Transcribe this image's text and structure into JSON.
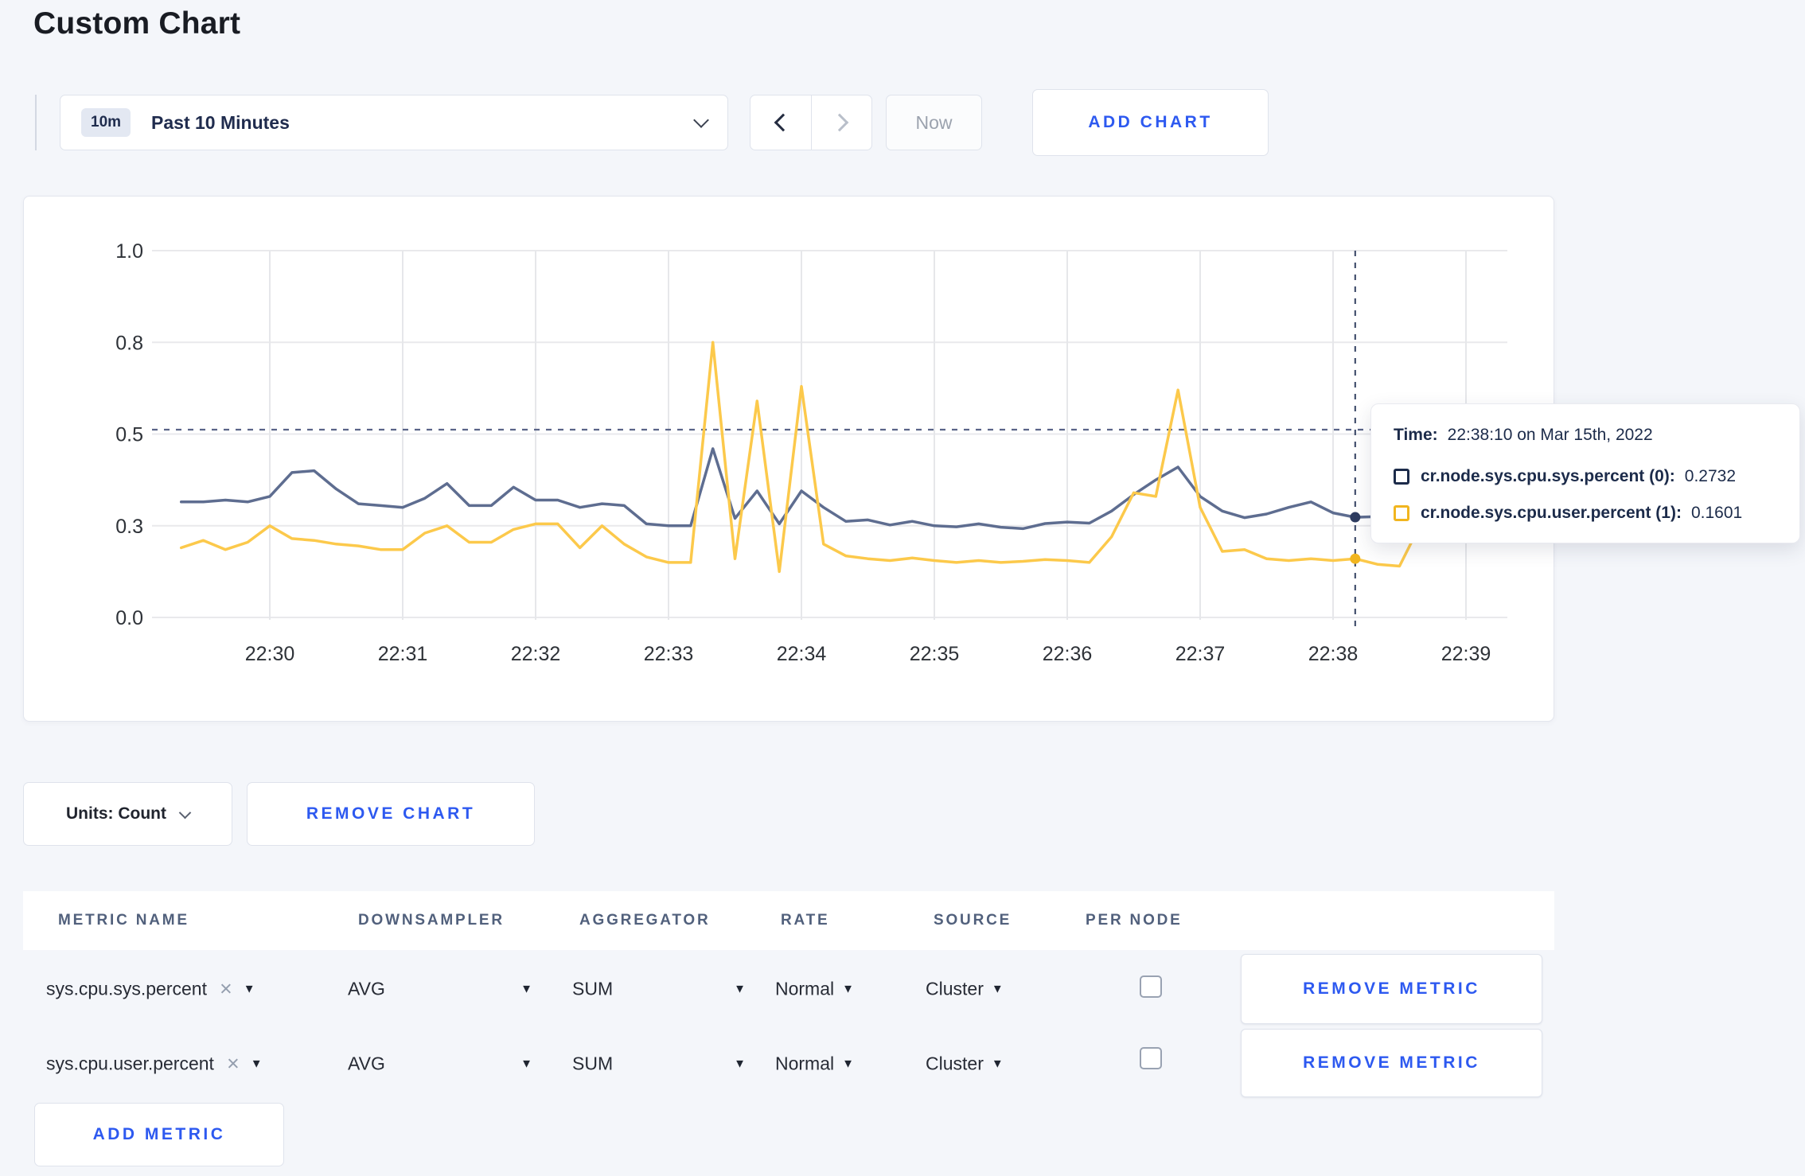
{
  "page": {
    "title": "Custom Chart"
  },
  "toolbar": {
    "range_badge": "10m",
    "range_label": "Past 10 Minutes",
    "now_label": "Now",
    "add_chart_label": "ADD CHART"
  },
  "chart_footer": {
    "units_label": "Units: Count",
    "remove_chart_label": "REMOVE CHART"
  },
  "tooltip": {
    "time_label": "Time:",
    "time_value": "22:38:10 on Mar 15th, 2022",
    "rows": [
      {
        "name": "cr.node.sys.cpu.sys.percent (0):",
        "value": "0.2732",
        "swatch": "#1c2b4a"
      },
      {
        "name": "cr.node.sys.cpu.user.percent (1):",
        "value": "0.1601",
        "swatch": "#f1b51f"
      }
    ]
  },
  "chart_data": {
    "type": "line",
    "title": "",
    "xlabel": "",
    "ylabel": "",
    "ylim": [
      0,
      1
    ],
    "grid": true,
    "x_tick_labels": [
      "22:30",
      "22:31",
      "22:32",
      "22:33",
      "22:34",
      "22:35",
      "22:36",
      "22:37",
      "22:38",
      "22:39"
    ],
    "y_tick_labels": [
      "0.0",
      "0.3",
      "0.5",
      "0.8",
      "1.0"
    ],
    "y_tick_values": [
      0,
      0.25,
      0.5,
      0.75,
      1.0
    ],
    "x_start_sec_from_2230": -40,
    "x_step_sec": 10,
    "series": [
      {
        "name": "cr.node.sys.cpu.sys.percent (0)",
        "color": "#5e6d90",
        "dot_color": "#2e3c60",
        "values": [
          0.315,
          0.315,
          0.32,
          0.315,
          0.33,
          0.395,
          0.4,
          0.35,
          0.31,
          0.305,
          0.3,
          0.325,
          0.365,
          0.305,
          0.305,
          0.355,
          0.32,
          0.32,
          0.3,
          0.31,
          0.305,
          0.255,
          0.25,
          0.25,
          0.46,
          0.27,
          0.345,
          0.255,
          0.345,
          0.3,
          0.262,
          0.266,
          0.252,
          0.262,
          0.25,
          0.247,
          0.255,
          0.246,
          0.242,
          0.256,
          0.26,
          0.257,
          0.29,
          0.335,
          0.375,
          0.41,
          0.33,
          0.29,
          0.272,
          0.282,
          0.3,
          0.315,
          0.285,
          0.2732,
          0.275,
          0.27,
          0.272,
          0.27,
          0.268,
          0.27
        ]
      },
      {
        "name": "cr.node.sys.cpu.user.percent (1)",
        "color": "#fcc94b",
        "dot_color": "#f1b51f",
        "values": [
          0.19,
          0.21,
          0.185,
          0.205,
          0.25,
          0.215,
          0.21,
          0.2,
          0.195,
          0.185,
          0.185,
          0.23,
          0.25,
          0.205,
          0.205,
          0.24,
          0.255,
          0.255,
          0.19,
          0.25,
          0.2,
          0.165,
          0.15,
          0.15,
          0.75,
          0.16,
          0.59,
          0.125,
          0.63,
          0.2,
          0.168,
          0.16,
          0.155,
          0.162,
          0.155,
          0.15,
          0.155,
          0.15,
          0.153,
          0.158,
          0.155,
          0.15,
          0.22,
          0.34,
          0.33,
          0.62,
          0.3,
          0.18,
          0.185,
          0.16,
          0.155,
          0.16,
          0.155,
          0.1601,
          0.145,
          0.14,
          0.26,
          0.295,
          0.245,
          0.28
        ]
      }
    ],
    "crosshair": {
      "time_sec_from_2230": 490,
      "hline_value": 0.512,
      "time_text": "22:38:10 on Mar 15th, 2022"
    }
  },
  "metrics_table": {
    "headers": [
      "METRIC NAME",
      "DOWNSAMPLER",
      "AGGREGATOR",
      "RATE",
      "SOURCE",
      "PER NODE"
    ],
    "remove_metric_label": "REMOVE METRIC",
    "add_metric_label": "ADD METRIC",
    "rows": [
      {
        "metric": "sys.cpu.sys.percent",
        "downsampler": "AVG",
        "aggregator": "SUM",
        "rate": "Normal",
        "source": "Cluster",
        "per_node_checked": false
      },
      {
        "metric": "sys.cpu.user.percent",
        "downsampler": "AVG",
        "aggregator": "SUM",
        "rate": "Normal",
        "source": "Cluster",
        "per_node_checked": false
      }
    ]
  }
}
